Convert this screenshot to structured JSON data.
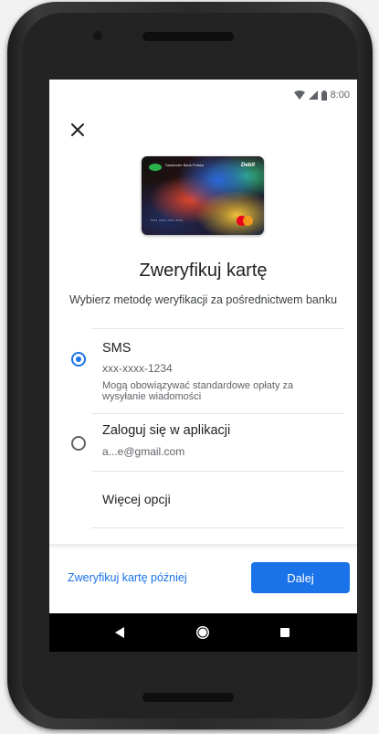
{
  "status_bar": {
    "time": "8:00",
    "icons": [
      "wifi-icon",
      "signal-icon",
      "battery-icon"
    ]
  },
  "header": {
    "close_icon": "close-icon"
  },
  "card": {
    "type_label": "Debit",
    "bank_label": "Santander Bank Polska",
    "network": "mastercard"
  },
  "main": {
    "title": "Zweryfikuj kartę",
    "subtitle": "Wybierz metodę weryfikacji za pośrednictwem banku"
  },
  "options": [
    {
      "title": "SMS",
      "detail": "xxx-xxxx-1234",
      "note": "Mogą obowiązywać standardowe opłaty za wysyłanie wiadomości",
      "selected": true
    },
    {
      "title": "Zaloguj się w aplikacji",
      "detail": "a...e@gmail.com",
      "selected": false
    }
  ],
  "more_options": "Więcej opcji",
  "footer": {
    "later_link": "Zweryfikuj kartę później",
    "next_button": "Dalej"
  },
  "colors": {
    "accent": "#1a73e8",
    "text": "#202124",
    "secondary": "#5f6368"
  },
  "nav_bar": {
    "icons": [
      "back-icon",
      "home-icon",
      "recents-icon"
    ]
  }
}
